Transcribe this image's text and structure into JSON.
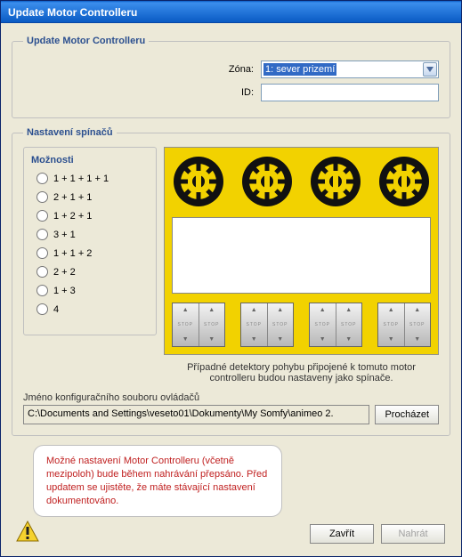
{
  "window": {
    "title": "Update Motor Controlleru"
  },
  "group_main": {
    "legend": "Update Motor Controlleru",
    "zone_label": "Zóna:",
    "zone_value": "1: sever prizemí",
    "id_label": "ID:",
    "id_value": ""
  },
  "group_switch": {
    "legend": "Nastavení spínačů",
    "options_title": "Možnosti",
    "options": [
      "1 + 1 + 1 + 1",
      "2 + 1 + 1",
      "1 + 2 + 1",
      "3 + 1",
      "1 + 1 + 2",
      "2 + 2",
      "1 + 3",
      "4"
    ],
    "detector_note": "Případné detektory pohybu připojené k tomuto motor controlleru budou nastaveny jako spínače.",
    "config_label": "Jméno konfiguračního souboru ovládačů",
    "config_path": "C:\\Documents and Settings\\veseto01\\Dokumenty\\My Somfy\\animeo 2.",
    "browse_label": "Procházet"
  },
  "warning": {
    "text": "Možné nastavení Motor Controlleru (včetně mezipoloh) bude během nahrávání přepsáno. Před updatem se ujistěte, že máte stávající nastavení dokumentováno."
  },
  "buttons": {
    "close": "Zavřít",
    "upload": "Nahrát"
  },
  "switch_labels": {
    "stop": "STOP"
  }
}
